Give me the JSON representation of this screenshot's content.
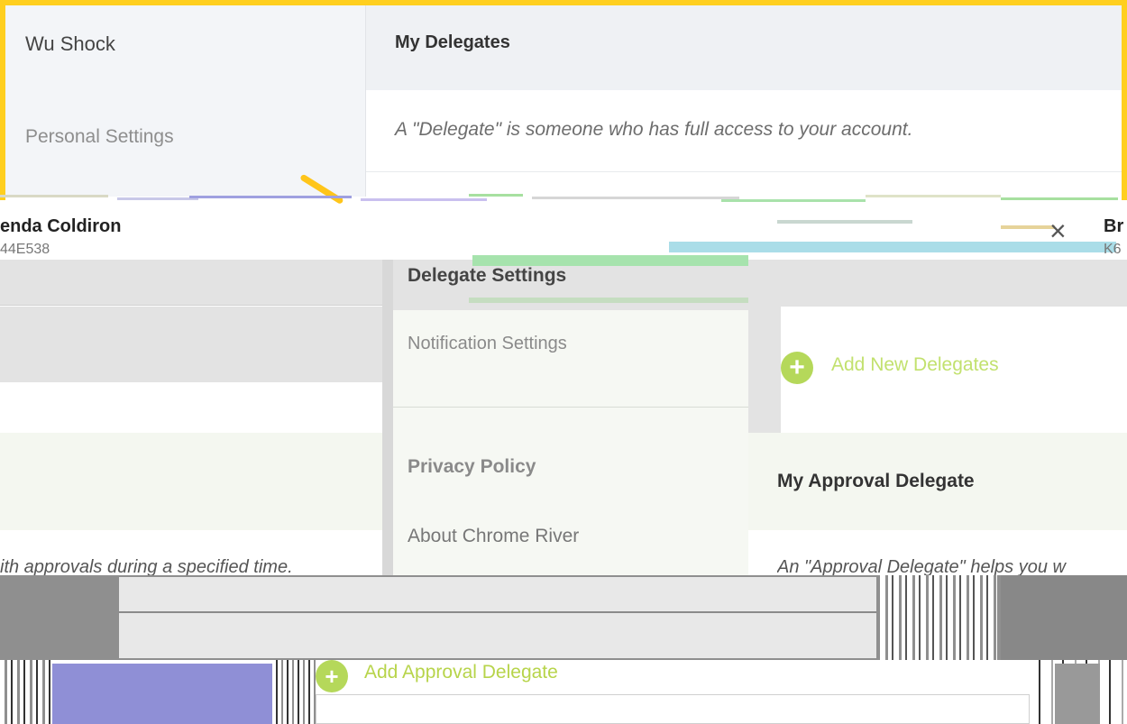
{
  "top_panel": {
    "user_name": "Wu Shock",
    "personal_settings_label": "Personal Settings",
    "section_title": "My Delegates",
    "section_description": "A \"Delegate\" is someone who has full access to your account."
  },
  "employee": {
    "name_partial": "enda Coldiron",
    "id_partial": "44E538",
    "right_name_partial": "Br",
    "right_id_partial": "K6",
    "close_glyph": "×"
  },
  "menu": {
    "items": [
      {
        "label": "Delegate Settings"
      },
      {
        "label": "Notification Settings"
      },
      {
        "label": "Privacy Policy"
      },
      {
        "label": "About Chrome River"
      }
    ]
  },
  "delegates": {
    "add_new_label": "Add New Delegates",
    "add_icon": "plus-icon"
  },
  "approval": {
    "title": "My Approval Delegate",
    "description_left_partial": "ith approvals during a specified time.",
    "description_right_partial": "An \"Approval Delegate\" helps you w",
    "add_label": "Add Approval Delegate"
  },
  "colors": {
    "highlight_border": "#ffcf1f",
    "accent_green": "#b5d85a",
    "glitch_purple": "#8f8fd6",
    "glitch_cyan": "#aadde8"
  }
}
